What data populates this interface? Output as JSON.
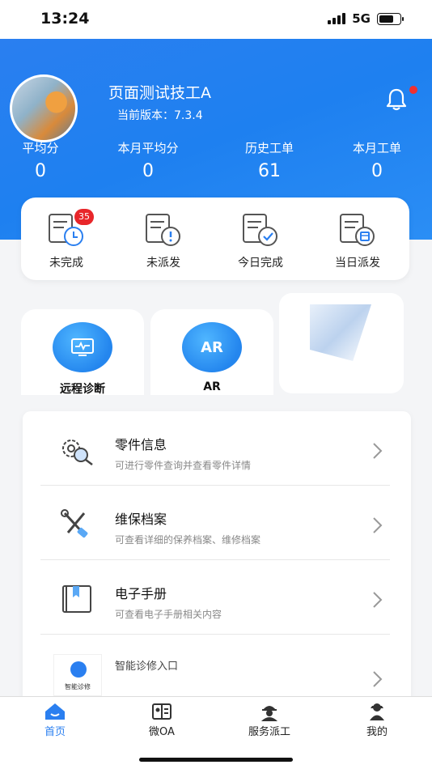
{
  "status_bar": {
    "time": "13:24",
    "network": "5G"
  },
  "profile": {
    "name": "页面测试技工A",
    "version": "当前版本：7.3.4"
  },
  "stats": [
    {
      "label": "平均分",
      "value": "0"
    },
    {
      "label": "本月平均分",
      "value": "0"
    },
    {
      "label": "历史工单",
      "value": "61"
    },
    {
      "label": "本月工单",
      "value": "0"
    }
  ],
  "orders": [
    {
      "label": "未完成",
      "badge": "35",
      "icon": "clock-doc-icon"
    },
    {
      "label": "未派发",
      "icon": "alert-doc-icon"
    },
    {
      "label": "今日完成",
      "icon": "check-doc-icon"
    },
    {
      "label": "当日派发",
      "icon": "calendar-doc-icon"
    }
  ],
  "tiles": [
    {
      "label": "远程诊断",
      "icon": "monitor-icon"
    },
    {
      "label": "AR",
      "icon": "ar-icon",
      "icon_text": "AR"
    }
  ],
  "menu": [
    {
      "title": "零件信息",
      "subtitle": "可进行零件查询并查看零件详情",
      "icon": "gear-search-icon"
    },
    {
      "title": "维保档案",
      "subtitle": "可查看详细的保养档案、维修档案",
      "icon": "wrench-tools-icon"
    },
    {
      "title": "电子手册",
      "subtitle": "可查看电子手册相关内容",
      "icon": "book-icon"
    },
    {
      "title": "智能诊修入口",
      "thumb_text": "智能诊修",
      "icon": "thumb-image"
    }
  ],
  "tabbar": [
    {
      "label": "首页",
      "icon": "home-icon",
      "active": true
    },
    {
      "label": "微OA",
      "icon": "oa-icon"
    },
    {
      "label": "服务派工",
      "icon": "worker-icon"
    },
    {
      "label": "我的",
      "icon": "profile-icon"
    }
  ],
  "colors": {
    "brand": "#2a7ff0",
    "badge": "#e8262a"
  }
}
